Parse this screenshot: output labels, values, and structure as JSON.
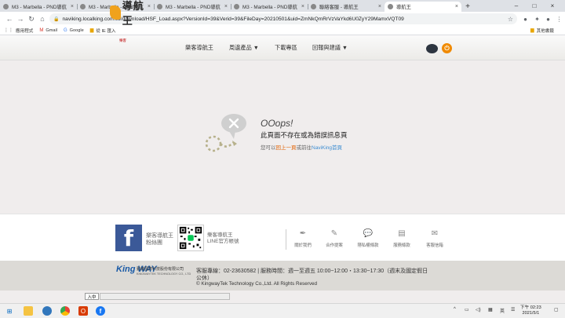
{
  "browser": {
    "tabs": [
      {
        "title": "M3 - Marbella - PND導航",
        "active": false
      },
      {
        "title": "M3 - Marbella - PND導航",
        "active": false
      },
      {
        "title": "M3 - Marbella - PND導航",
        "active": false
      },
      {
        "title": "M3 - Marbella - PND導航",
        "active": false
      },
      {
        "title": "聯絡客服 - 導航王",
        "active": false
      },
      {
        "title": "導航王",
        "active": true
      }
    ],
    "url": "naviking.localking.com.tw/download/HSF_Load.aspx?VersionId=39&Verid=39&FileDay=20210501&uid=ZmNkQmRrVzVaYkd6U0ZyY29MamxVQT09",
    "bookmarks": [
      {
        "label": "應用程式",
        "icon": "apps-icon"
      },
      {
        "label": "Gmail",
        "icon": "gmail-icon"
      },
      {
        "label": "Google",
        "icon": "google-icon"
      },
      {
        "label": "從 IE 匯入",
        "icon": "folder-icon"
      }
    ],
    "other_bookmarks": "其他書籤"
  },
  "site": {
    "nav": [
      {
        "label": "樂客導航王"
      },
      {
        "label": "周邊產品 ▼"
      },
      {
        "label": "下載專區"
      },
      {
        "label": "回報與建議 ▼"
      }
    ],
    "logo_text": "導航王",
    "logo_tag": "樂客"
  },
  "error": {
    "oops": "OOops!",
    "title": "此頁面不存在或為錯誤訊息頁",
    "hint_prefix": "您可以",
    "hint_back": "回上一頁",
    "hint_mid": "或前往",
    "hint_home": "NaviKing首頁"
  },
  "footer": {
    "fb_label_1": "樂客導航王",
    "fb_label_2": "粉絲團",
    "line_label_1": "樂客導航王",
    "line_label_2": "LINE官方帳號",
    "links": [
      {
        "label": "關於我們",
        "icon": "pen-icon"
      },
      {
        "label": "合作提案",
        "icon": "pencil-icon"
      },
      {
        "label": "隱私權條款",
        "icon": "chat-icon"
      },
      {
        "label": "服務條款",
        "icon": "document-icon"
      },
      {
        "label": "客服信箱",
        "icon": "mail-icon"
      }
    ],
    "company_logo": "King WAY",
    "company_name": "勤崴國際科技股份有限公司",
    "company_en": "KINGWAYTEK TECHNOLOGY CO., LTD",
    "service": "客服專線：02-23630582 | 服務時間：週一至週五 10:00~12:00・13:30~17:30（週末及國定假日",
    "service2": "公休）",
    "copyright": "© KingwayTek Technology Co.,Ltd. All Rights Reserved"
  },
  "ime": "入中",
  "taskbar": {
    "lang": "英",
    "clock_time": "下午 02:23",
    "clock_date": "2021/5/1"
  }
}
